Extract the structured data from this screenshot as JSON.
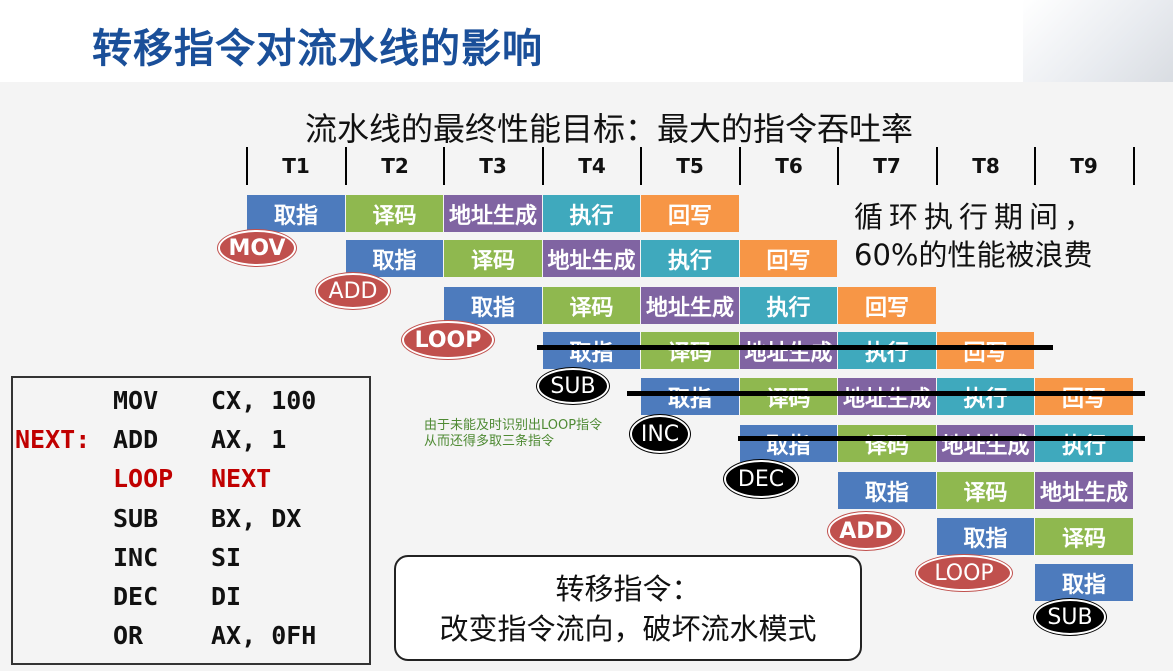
{
  "title": "转移指令对流水线的影响",
  "subtitle": "流水线的最终性能目标：最大的指令吞吐率",
  "time_labels": [
    "T1",
    "T2",
    "T3",
    "T4",
    "T5",
    "T6",
    "T7",
    "T8",
    "T9"
  ],
  "stages": {
    "fetch": "取指",
    "decode": "译码",
    "addr": "地址生成",
    "exec": "执行",
    "write": "回写"
  },
  "instructions": [
    "MOV",
    "ADD",
    "LOOP",
    "SUB",
    "INC",
    "DEC",
    "ADD",
    "LOOP",
    "SUB"
  ],
  "note": {
    "line1": "循环执行期间，",
    "line2": "60%的性能被浪费"
  },
  "small_note": {
    "line1": "由于未能及时识别出LOOP指令",
    "line2": "从而还得多取三条指令"
  },
  "code": [
    {
      "label": "",
      "op": "MOV",
      "args": "CX, 100"
    },
    {
      "label": "NEXT:",
      "op": "ADD",
      "args": "AX, 1"
    },
    {
      "label": "",
      "op": "LOOP",
      "args": "NEXT"
    },
    {
      "label": "",
      "op": "SUB",
      "args": "BX, DX"
    },
    {
      "label": "",
      "op": "INC",
      "args": "SI"
    },
    {
      "label": "",
      "op": "DEC",
      "args": "DI"
    },
    {
      "label": "",
      "op": "OR",
      "args": "AX, 0FH"
    }
  ],
  "callout": {
    "line1": "转移指令：",
    "line2": "改变指令流向，破坏流水模式"
  },
  "colors": {
    "title": "#1a4f99",
    "fetch": "#4d7bbd",
    "decode": "#8fb84f",
    "addr": "#8064a2",
    "exec": "#3fa9bd",
    "write": "#f79646",
    "badge_red": "#c0504d",
    "code_red": "#c00000"
  }
}
